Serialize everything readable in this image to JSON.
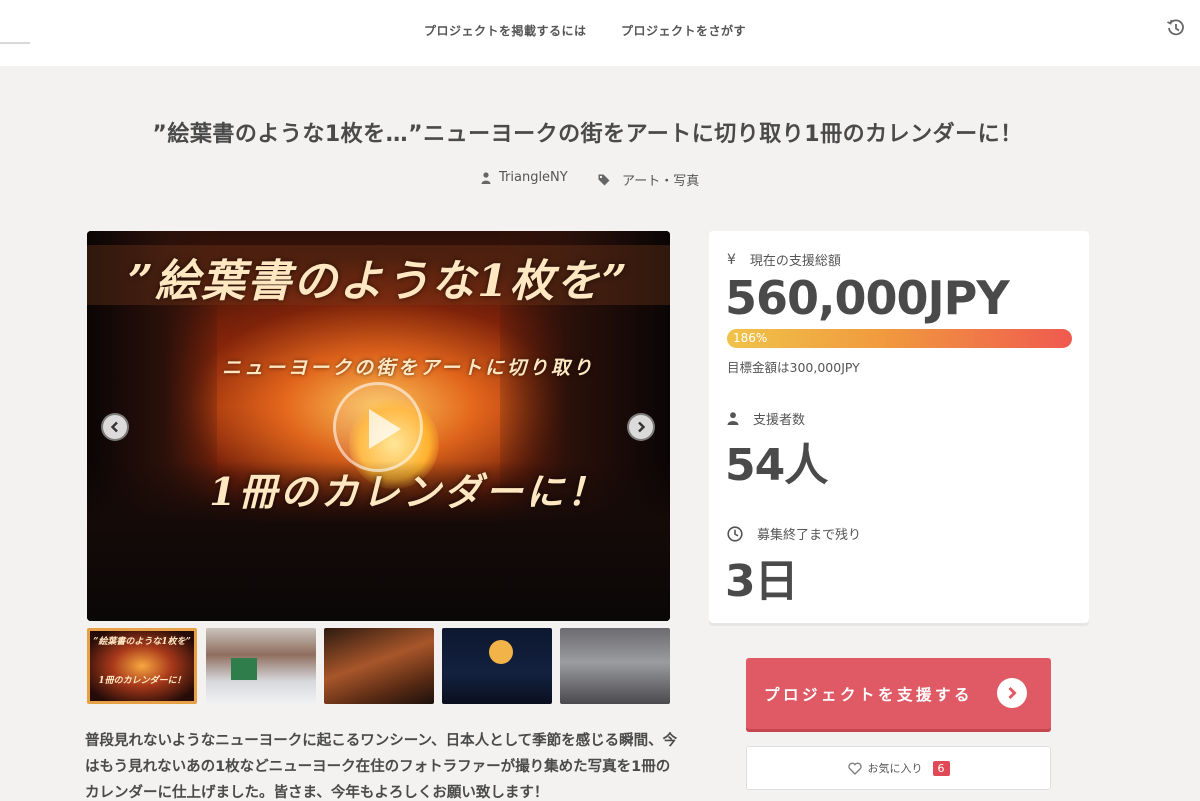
{
  "nav": {
    "link1": "プロジェクトを掲載するには",
    "link2": "プロジェクトをさがす"
  },
  "project": {
    "title": "”絵葉書のような1枚を…”ニューヨークの街をアートに切り取り1冊のカレンダーに！",
    "owner": "TriangleNY",
    "category": "アート・写真"
  },
  "hero": {
    "line1": "”絵葉書のような1枚を”",
    "line2": "ニューヨークの街をアートに切り取り",
    "line3": "1冊のカレンダーに！"
  },
  "thumbs": {
    "first_caption_top": "”絵葉書のような1枚を”",
    "first_caption_bottom": "1冊のカレンダーに！"
  },
  "description": "普段見れないようなニューヨークに起こるワンシーン、日本人として季節を感じる瞬間、今はもう見れないあの1枚などニューヨーク在住のフォトラファーが撮り集めた写真を1冊のカレンダーに仕上げました。皆さま、今年もよろしくお願い致します！",
  "stats": {
    "amount_label": "現在の支援総額",
    "amount_value": "560,000JPY",
    "progress_text": "186%",
    "progress_percent": 186,
    "goal_text": "目標金額は300,000JPY",
    "backers_label": "支援者数",
    "backers_value": "54人",
    "remaining_label": "募集終了まで残り",
    "remaining_value": "3日"
  },
  "actions": {
    "support_label": "プロジェクトを支援する",
    "favorite_label": "お気に入り",
    "favorite_count": "6"
  },
  "icons": {
    "yen": "¥"
  },
  "colors": {
    "support_button": "#df5a64",
    "progress_start": "#f0c34a",
    "progress_end": "#ef5a4f",
    "thumb_active_border": "#e8a046"
  }
}
